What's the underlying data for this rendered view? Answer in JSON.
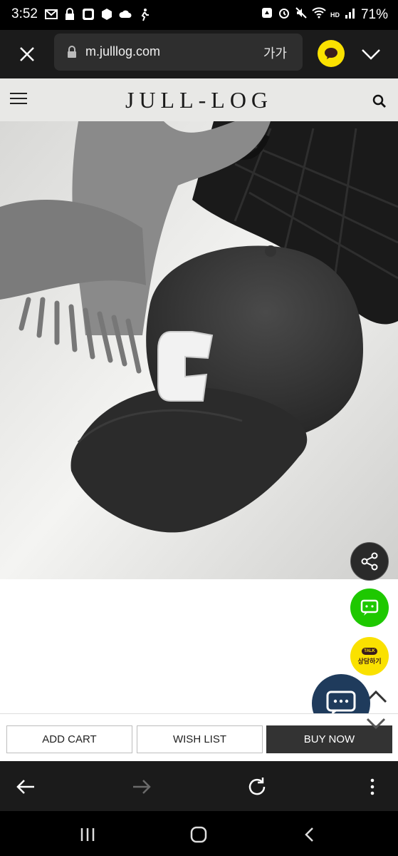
{
  "status_bar": {
    "time": "3:52",
    "battery": "71%",
    "network_label": "HD"
  },
  "browser": {
    "url": "m.julllog.com",
    "font_size_label": "가가"
  },
  "site": {
    "logo": "JULL-LOG"
  },
  "floating": {
    "talk_bubble": "TALK",
    "talk_label": "상담하기"
  },
  "actions": {
    "add_cart": "ADD CART",
    "wish_list": "WISH LIST",
    "buy_now": "BUY NOW"
  },
  "colors": {
    "kakao_yellow": "#fae100",
    "naver_green": "#1ec800",
    "support_navy": "#1f3b5c",
    "buy_now_bg": "#333333"
  }
}
